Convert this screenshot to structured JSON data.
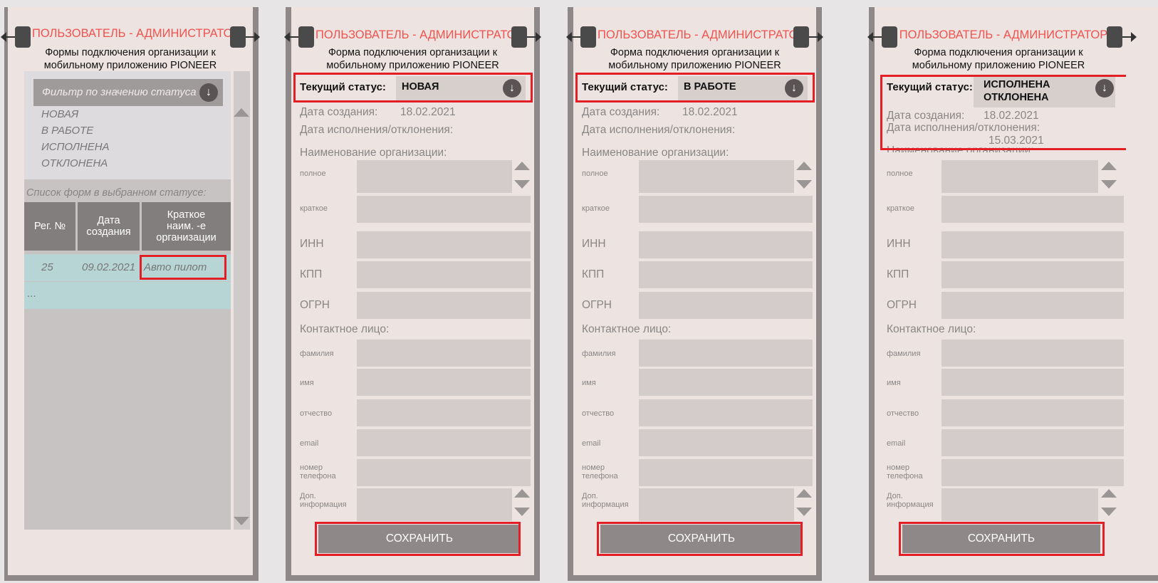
{
  "header": {
    "title": "ПОЛЬЗОВАТЕЛЬ - АДМИНИСТРАТОР"
  },
  "list_screen": {
    "subtitle_line1": "Формы подключения организации к",
    "subtitle_line2": "мобильному приложению PIONEER",
    "filter_placeholder": "Фильтр по значению статуса",
    "filter_options": [
      "НОВАЯ",
      "В РАБОТЕ",
      "ИСПОЛНЕНА",
      "ОТКЛОНЕНА"
    ],
    "list_label": "Список форм в выбранном статусе:",
    "columns": [
      "Рег. №",
      "Дата создания",
      "Краткое наим. -е организации"
    ],
    "col2_l1": "Дата",
    "col2_l2": "создания",
    "col3_l1": "Краткое",
    "col3_l2": "наим. -е",
    "col3_l3": "организации",
    "rows": [
      {
        "reg": "25",
        "date": "09.02.2021",
        "name": "Авто пилот"
      }
    ],
    "more": "..."
  },
  "form": {
    "subtitle_line1": "Форма подключения организации к",
    "subtitle_line2": "мобильному приложению PIONEER",
    "status_label": "Текущий статус:",
    "created_label": "Дата создания:",
    "created_value": "18.02.2021",
    "completion_label": "Дата исполнения/отклонения:",
    "org_label": "Наименование организации:",
    "full_label": "полное",
    "short_label": "краткое",
    "inn_label": "ИНН",
    "kpp_label": "КПП",
    "ogrn_label": "ОГРН",
    "contact_label": "Контактное лицо:",
    "surname_label": "фамилия",
    "name_label": "имя",
    "patronymic_label": "отчество",
    "email_label": "email",
    "phone_l1": "номер",
    "phone_l2": "телефона",
    "extra_l1": "Доп.",
    "extra_l2": "информация",
    "save_label": "СОХРАНИТЬ"
  },
  "screens": [
    {
      "status": "НОВАЯ"
    },
    {
      "status": "В РАБОТЕ"
    },
    {
      "status_l1": "ИСПОЛНЕНА",
      "status_l2": "ОТКЛОНЕНА",
      "completion_value": "15.03.2021"
    }
  ],
  "colors": {
    "accent": "#f0524d",
    "highlight": "#e31e24",
    "frame": "#8e8888",
    "panel": "#ede4e2"
  }
}
